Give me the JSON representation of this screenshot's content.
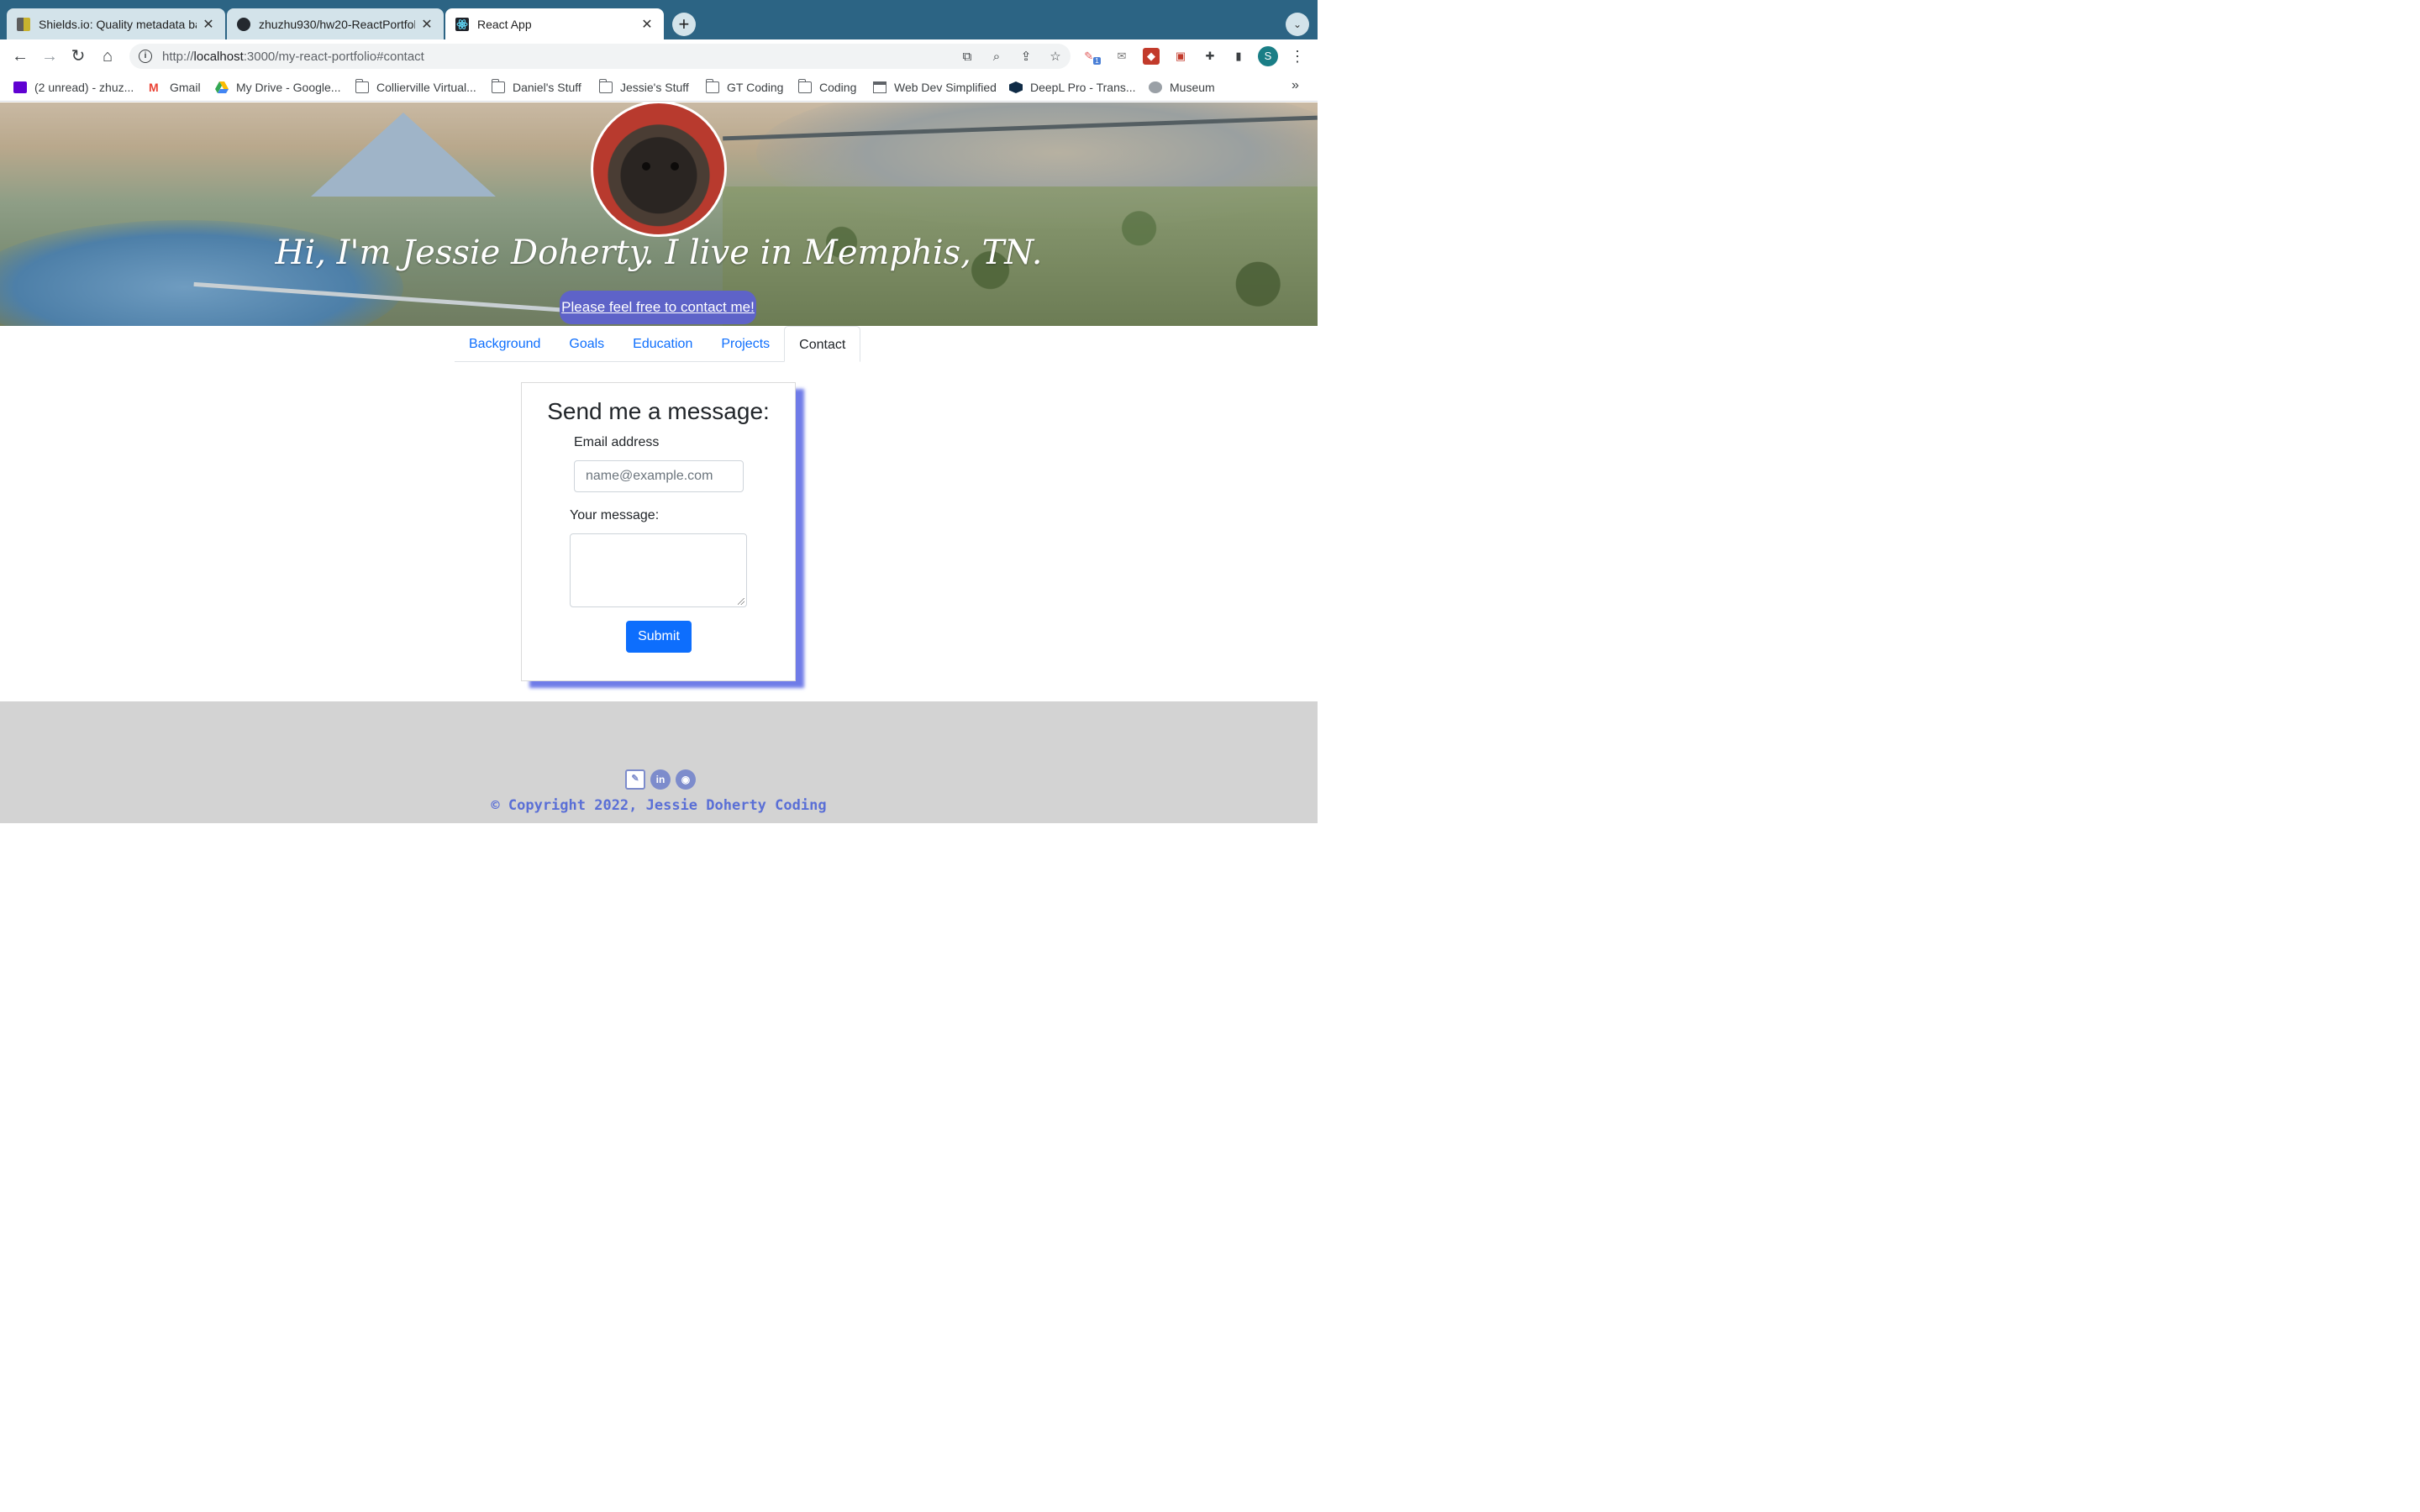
{
  "browser": {
    "tabs": [
      {
        "title": "Shields.io: Quality metadata ba",
        "active": false
      },
      {
        "title": "zhuzhu930/hw20-ReactPortfol",
        "active": false
      },
      {
        "title": "React App",
        "active": true
      }
    ],
    "url_prefix": "http://",
    "url_host": "localhost",
    "url_rest": ":3000/my-react-portfolio#contact",
    "extension_badge": "1",
    "profile_initial": "S",
    "bookmarks": [
      {
        "label": "(2 unread) - zhuz...",
        "icon": "yahoo-mail-icon"
      },
      {
        "label": "Gmail",
        "icon": "gmail-icon"
      },
      {
        "label": "My Drive - Google...",
        "icon": "google-drive-icon"
      },
      {
        "label": "Collierville Virtual...",
        "icon": "folder-icon"
      },
      {
        "label": "Daniel's Stuff",
        "icon": "folder-icon"
      },
      {
        "label": "Jessie's Stuff",
        "icon": "folder-icon"
      },
      {
        "label": "GT Coding",
        "icon": "folder-icon"
      },
      {
        "label": "Coding",
        "icon": "folder-icon"
      },
      {
        "label": "Web Dev Simplified",
        "icon": "store-icon"
      },
      {
        "label": "DeepL Pro - Trans...",
        "icon": "deepl-icon"
      },
      {
        "label": "Museum",
        "icon": "globe-icon"
      }
    ],
    "bookmarks_overflow": "»"
  },
  "hero": {
    "title": "Hi, I'm Jessie Doherty. I live in Memphis, TN.",
    "cta": "Please feel free to contact me!"
  },
  "nav": {
    "tabs": [
      "Background",
      "Goals",
      "Education",
      "Projects",
      "Contact"
    ],
    "active": "Contact"
  },
  "contact_form": {
    "heading": "Send me a message:",
    "email_label": "Email address",
    "email_placeholder": "name@example.com",
    "message_label": "Your message:",
    "submit": "Submit"
  },
  "footer": {
    "icons": [
      "resume-icon",
      "linkedin-icon",
      "github-icon"
    ],
    "copyright": "© Copyright 2022, Jessie Doherty Coding"
  },
  "colors": {
    "tabstrip": "#2c6484",
    "link": "#0d6efd",
    "card_shadow": "#6f7be8",
    "footer_text": "#5a6fd6"
  }
}
